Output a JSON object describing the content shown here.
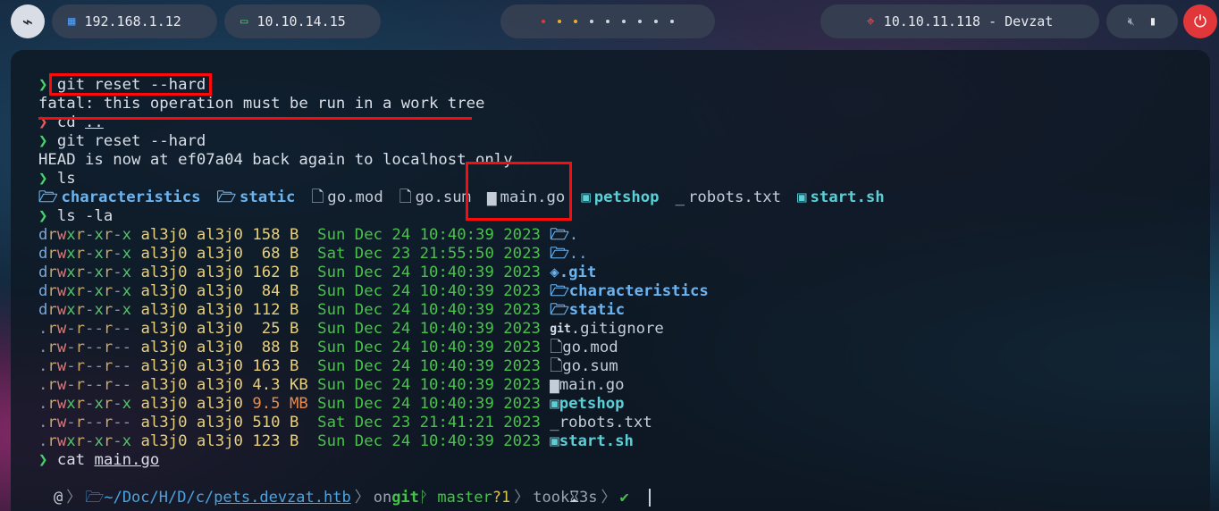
{
  "topbar": {
    "logo_icon": "kali-dragon-icon",
    "ip1": "192.168.1.12",
    "ip2": "10.10.14.15",
    "target": "10.10.11.118 - Devzat",
    "dot_colors": [
      "#e2373a",
      "#f0b020",
      "#f0b020",
      "#cfd4dc",
      "#cfd4dc",
      "#cfd4dc",
      "#cfd4dc",
      "#cfd4dc",
      "#cfd4dc"
    ]
  },
  "terminal": {
    "lines": [
      {
        "type": "cmd",
        "arrow": "❯",
        "arrow_color": "green",
        "text": "git reset --hard"
      },
      {
        "type": "out",
        "text": "fatal: this operation must be run in a work tree"
      },
      {
        "type": "cmd",
        "arrow": "❯",
        "arrow_color": "red",
        "text": "cd ..",
        "underline_arg": ".."
      },
      {
        "type": "cmd",
        "arrow": "❯",
        "arrow_color": "green",
        "text": "git reset --hard"
      },
      {
        "type": "out",
        "text": "HEAD is now at ef07a04 back again to localhost only"
      },
      {
        "type": "cmd",
        "arrow": "❯",
        "arrow_color": "green",
        "text": "ls"
      }
    ],
    "ls_items": [
      {
        "icon": "folder-icon",
        "glyph": "🗁",
        "name": "characteristics",
        "kind": "dir"
      },
      {
        "icon": "folder-icon",
        "glyph": "🗁",
        "name": "static",
        "kind": "dir"
      },
      {
        "icon": "file-icon",
        "glyph": "🗋",
        "name": "go.mod",
        "kind": "file"
      },
      {
        "icon": "file-icon",
        "glyph": "🗋",
        "name": "go.sum",
        "kind": "file"
      },
      {
        "icon": "go-file-icon",
        "glyph": "▆",
        "name": "main.go",
        "kind": "file"
      },
      {
        "icon": "terminal-icon",
        "glyph": "▣",
        "name": "petshop",
        "kind": "exec"
      },
      {
        "icon": "text-file-icon",
        "glyph": "_",
        "name": "robots.txt",
        "kind": "file"
      },
      {
        "icon": "terminal-icon",
        "glyph": "▣",
        "name": "start.sh",
        "kind": "exec"
      }
    ],
    "ls_la_cmd": "ls -la",
    "ls_la_rows": [
      {
        "perm": "drwxr-xr-x",
        "user": "al3j0",
        "group": "al3j0",
        "size": "158 B",
        "date": "Sun Dec 24 10:40:39 2023",
        "icon": "folder-icon",
        "glyph": "🗁",
        "name": ".",
        "kind": "dirplain"
      },
      {
        "perm": "drwxr-xr-x",
        "user": "al3j0",
        "group": "al3j0",
        "size": " 68 B",
        "date": "Sat Dec 23 21:55:50 2023",
        "icon": "folder-icon",
        "glyph": "🗁",
        "name": "..",
        "kind": "dirplain"
      },
      {
        "perm": "drwxr-xr-x",
        "user": "al3j0",
        "group": "al3j0",
        "size": "162 B",
        "date": "Sun Dec 24 10:40:39 2023",
        "icon": "git-folder-icon",
        "glyph": "◈",
        "name": ".git",
        "kind": "dir"
      },
      {
        "perm": "drwxr-xr-x",
        "user": "al3j0",
        "group": "al3j0",
        "size": " 84 B",
        "date": "Sun Dec 24 10:40:39 2023",
        "icon": "folder-icon",
        "glyph": "🗁",
        "name": "characteristics",
        "kind": "dir"
      },
      {
        "perm": "drwxr-xr-x",
        "user": "al3j0",
        "group": "al3j0",
        "size": "112 B",
        "date": "Sun Dec 24 10:40:39 2023",
        "icon": "folder-icon",
        "glyph": "🗁",
        "name": "static",
        "kind": "dir"
      },
      {
        "perm": ".rw-r--r--",
        "user": "al3j0",
        "group": "al3j0",
        "size": " 25 B",
        "date": "Sun Dec 24 10:40:39 2023",
        "icon": "git-icon",
        "glyph": "git",
        "name": ".gitignore",
        "kind": "file"
      },
      {
        "perm": ".rw-r--r--",
        "user": "al3j0",
        "group": "al3j0",
        "size": " 88 B",
        "date": "Sun Dec 24 10:40:39 2023",
        "icon": "file-icon",
        "glyph": "🗋",
        "name": "go.mod",
        "kind": "file"
      },
      {
        "perm": ".rw-r--r--",
        "user": "al3j0",
        "group": "al3j0",
        "size": "163 B",
        "date": "Sun Dec 24 10:40:39 2023",
        "icon": "file-icon",
        "glyph": "🗋",
        "name": "go.sum",
        "kind": "file"
      },
      {
        "perm": ".rw-r--r--",
        "user": "al3j0",
        "group": "al3j0",
        "size": "4.3 KB",
        "date": "Sun Dec 24 10:40:39 2023",
        "icon": "go-file-icon",
        "glyph": "▆",
        "name": "main.go",
        "kind": "file"
      },
      {
        "perm": ".rwxr-xr-x",
        "user": "al3j0",
        "group": "al3j0",
        "size": "9.5 MB",
        "date": "Sun Dec 24 10:40:39 2023",
        "icon": "terminal-icon",
        "glyph": "▣",
        "name": "petshop",
        "kind": "exec",
        "big": true
      },
      {
        "perm": ".rw-r--r--",
        "user": "al3j0",
        "group": "al3j0",
        "size": "510 B",
        "date": "Sat Dec 23 21:41:21 2023",
        "icon": "text-file-icon",
        "glyph": "_",
        "name": "robots.txt",
        "kind": "file"
      },
      {
        "perm": ".rwxr-xr-x",
        "user": "al3j0",
        "group": "al3j0",
        "size": "123 B",
        "date": "Sun Dec 24 10:40:39 2023",
        "icon": "terminal-icon",
        "glyph": "▣",
        "name": "start.sh",
        "kind": "exec"
      }
    ],
    "last_cmd": "cat",
    "last_arg": "main.go"
  },
  "prompt": {
    "os_icon": "debian-swirl-icon",
    "home": "~/Doc/H/D/c/",
    "dir": "pets.devzat.htb",
    "on": "on",
    "git_label": "git",
    "branch": "master",
    "status": "?1",
    "took": "took",
    "duration": "3s",
    "check": "✔"
  },
  "colors": {
    "highlight": "#ff0a0a",
    "prompt_green": "#46d46a",
    "prompt_red": "#e85a5a"
  }
}
